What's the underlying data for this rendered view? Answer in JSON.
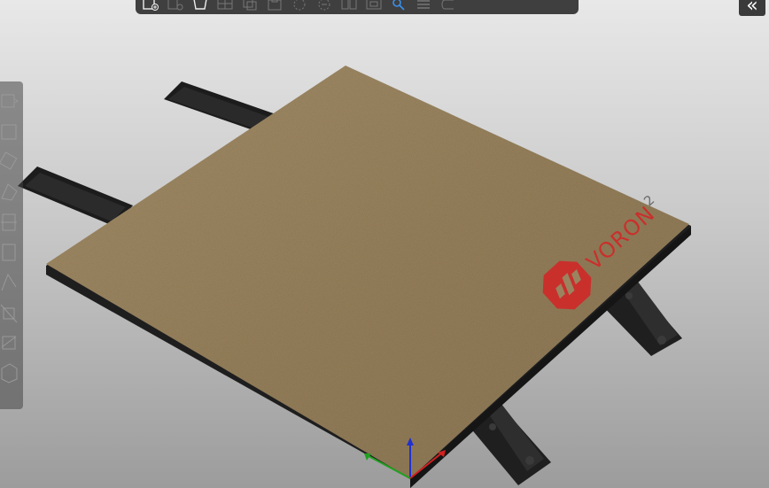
{
  "colors": {
    "plate": "#9a8460",
    "plate_edge": "#1e1e1e",
    "rail": "#1c1c1c",
    "logo_red": "#c9302c",
    "toolbar_bg": "#3f3f3f",
    "axis_x": "#d42020",
    "axis_y": "#20a020",
    "axis_z": "#2030d0"
  },
  "logo": {
    "text": "VORON",
    "sup": "2"
  },
  "collapse": {
    "label": "«"
  },
  "top_toolbar": {
    "icons": [
      "add-object-icon",
      "delete-icon",
      "delete-all-icon",
      "arrange-icon",
      "copy-icon",
      "paste-icon",
      "add-instance-icon",
      "remove-instance-icon",
      "split-objects-icon",
      "split-parts-icon",
      "variable-layer-height-icon",
      "search-icon",
      "layers-editor-icon",
      "undo-icon"
    ]
  },
  "left_toolbar": {
    "icons": [
      "move-icon",
      "scale-icon",
      "rotate-icon",
      "place-on-face-icon",
      "cut-icon",
      "support-painting-icon",
      "seam-painting-icon",
      "mmu-painting-icon",
      "measure-icon",
      "emboss-icon"
    ]
  }
}
